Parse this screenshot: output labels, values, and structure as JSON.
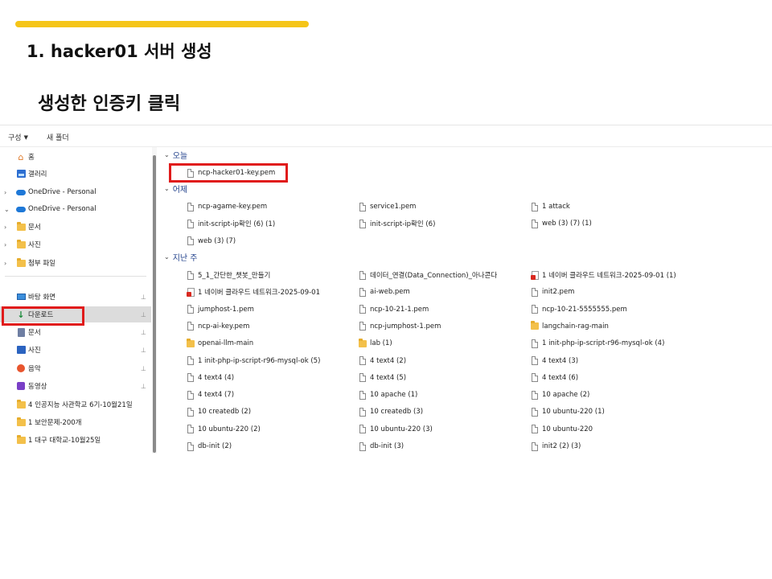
{
  "slide": {
    "title": "1. hacker01 서버 생성",
    "subtitle": "생성한 인증키 클릭",
    "accent_color": "#f5c518",
    "highlight_color": "#e01b1b"
  },
  "toolbar": {
    "organize_label": "구성",
    "new_folder_label": "새 폴더"
  },
  "nav": {
    "items": [
      {
        "label": "홈",
        "icon": "home-icon"
      },
      {
        "label": "갤러리",
        "icon": "gallery-icon"
      },
      {
        "label": "OneDrive - Personal",
        "icon": "cloud-icon",
        "chevron": "›"
      },
      {
        "label": "OneDrive - Personal",
        "icon": "cloud-icon",
        "chevron": "⌄"
      },
      {
        "label": "문서",
        "icon": "folder-icon",
        "chevron": "›"
      },
      {
        "label": "사진",
        "icon": "folder-icon",
        "chevron": "›"
      },
      {
        "label": "첨부 파일",
        "icon": "folder-icon",
        "chevron": "›"
      },
      {
        "label": "바탕 화면",
        "icon": "desktop-icon",
        "pinned": true
      },
      {
        "label": "다운로드",
        "icon": "download-icon",
        "pinned": true,
        "selected": true
      },
      {
        "label": "문서",
        "icon": "documents-icon",
        "pinned": true
      },
      {
        "label": "사진",
        "icon": "pictures-icon",
        "pinned": true
      },
      {
        "label": "음악",
        "icon": "music-icon",
        "pinned": true
      },
      {
        "label": "동영상",
        "icon": "videos-icon",
        "pinned": true
      },
      {
        "label": "4 인공지능 사관학교 6기-10월21일",
        "icon": "folder-icon"
      },
      {
        "label": "1 보안문제-200개",
        "icon": "folder-icon"
      },
      {
        "label": "1 대구 대학교-10월25일",
        "icon": "folder-icon"
      }
    ]
  },
  "groups": {
    "today": {
      "label": "오늘",
      "files": [
        {
          "name": "ncp-hacker01-key.pem",
          "icon": "file-icon"
        }
      ]
    },
    "yesterday": {
      "label": "어제",
      "files": [
        {
          "name": "ncp-agame-key.pem",
          "icon": "file-icon"
        },
        {
          "name": "service1.pem",
          "icon": "file-icon"
        },
        {
          "name": "1 attack",
          "icon": "file-icon"
        },
        {
          "name": "init-script-ip확인 (6) (1)",
          "icon": "file-icon"
        },
        {
          "name": "init-script-ip확인 (6)",
          "icon": "file-icon"
        },
        {
          "name": "web (3) (7) (1)",
          "icon": "file-icon"
        },
        {
          "name": "web (3) (7)",
          "icon": "file-icon"
        }
      ]
    },
    "older": {
      "label": "지난 주",
      "files": [
        {
          "name": "5_1_간단한_챗봇_만들기",
          "icon": "file-icon"
        },
        {
          "name": "데이터_연결(Data_Connection)_아나콘다",
          "icon": "file-icon"
        },
        {
          "name": "1 네이버 클라우드 네트워크-2025-09-01 (1)",
          "icon": "pdf-icon"
        },
        {
          "name": "1 네이버 클라우드 네트워크-2025-09-01",
          "icon": "pdf-icon"
        },
        {
          "name": "ai-web.pem",
          "icon": "file-icon"
        },
        {
          "name": "init2.pem",
          "icon": "file-icon"
        },
        {
          "name": "jumphost-1.pem",
          "icon": "file-icon"
        },
        {
          "name": "ncp-10-21-1.pem",
          "icon": "file-icon"
        },
        {
          "name": "ncp-10-21-5555555.pem",
          "icon": "file-icon"
        },
        {
          "name": "ncp-ai-key.pem",
          "icon": "file-icon"
        },
        {
          "name": "ncp-jumphost-1.pem",
          "icon": "file-icon"
        },
        {
          "name": "langchain-rag-main",
          "icon": "folder-icon"
        },
        {
          "name": "openai-llm-main",
          "icon": "folder-icon"
        },
        {
          "name": "lab (1)",
          "icon": "folder-icon"
        },
        {
          "name": "1 init-php-ip-script-r96-mysql-ok (4)",
          "icon": "file-icon"
        },
        {
          "name": "1 init-php-ip-script-r96-mysql-ok (5)",
          "icon": "file-icon"
        },
        {
          "name": "4 text4 (2)",
          "icon": "file-icon"
        },
        {
          "name": "4 text4 (3)",
          "icon": "file-icon"
        },
        {
          "name": "4 text4 (4)",
          "icon": "file-icon"
        },
        {
          "name": "4 text4 (5)",
          "icon": "file-icon"
        },
        {
          "name": "4 text4 (6)",
          "icon": "file-icon"
        },
        {
          "name": "4 text4 (7)",
          "icon": "file-icon"
        },
        {
          "name": "10 apache (1)",
          "icon": "file-icon"
        },
        {
          "name": "10 apache (2)",
          "icon": "file-icon"
        },
        {
          "name": "10 createdb (2)",
          "icon": "file-icon"
        },
        {
          "name": "10 createdb (3)",
          "icon": "file-icon"
        },
        {
          "name": "10 ubuntu-220 (1)",
          "icon": "file-icon"
        },
        {
          "name": "10 ubuntu-220 (2)",
          "icon": "file-icon"
        },
        {
          "name": "10 ubuntu-220 (3)",
          "icon": "file-icon"
        },
        {
          "name": "10 ubuntu-220",
          "icon": "file-icon"
        },
        {
          "name": "db-init (2)",
          "icon": "file-icon"
        },
        {
          "name": "db-init (3)",
          "icon": "file-icon"
        },
        {
          "name": "init2 (2) (3)",
          "icon": "file-icon"
        }
      ]
    }
  }
}
